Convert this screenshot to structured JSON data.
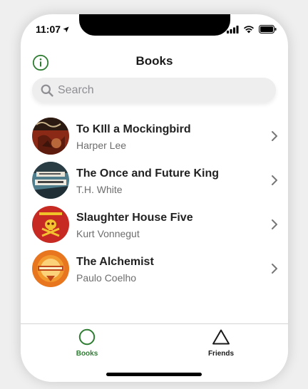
{
  "status_bar": {
    "time": "11:07"
  },
  "nav": {
    "title": "Books"
  },
  "search": {
    "placeholder": "Search"
  },
  "books": [
    {
      "title": "To KIll a Mockingbird",
      "author": "Harper Lee"
    },
    {
      "title": "The Once and Future King",
      "author": "T.H. White"
    },
    {
      "title": "Slaughter House Five",
      "author": "Kurt Vonnegut"
    },
    {
      "title": "The Alchemist",
      "author": "Paulo Coelho"
    }
  ],
  "tabs": [
    {
      "label": "Books",
      "active": true
    },
    {
      "label": "Friends",
      "active": false
    }
  ],
  "colors": {
    "accent": "#2e7d32",
    "inactive_tab": "#1a1a1a",
    "cover_mockingbird": "#8a2a16",
    "cover_once_future": "#4f7d8c",
    "cover_slaughterhouse": "#c62a23",
    "cover_alchemist": "#e8761e"
  }
}
